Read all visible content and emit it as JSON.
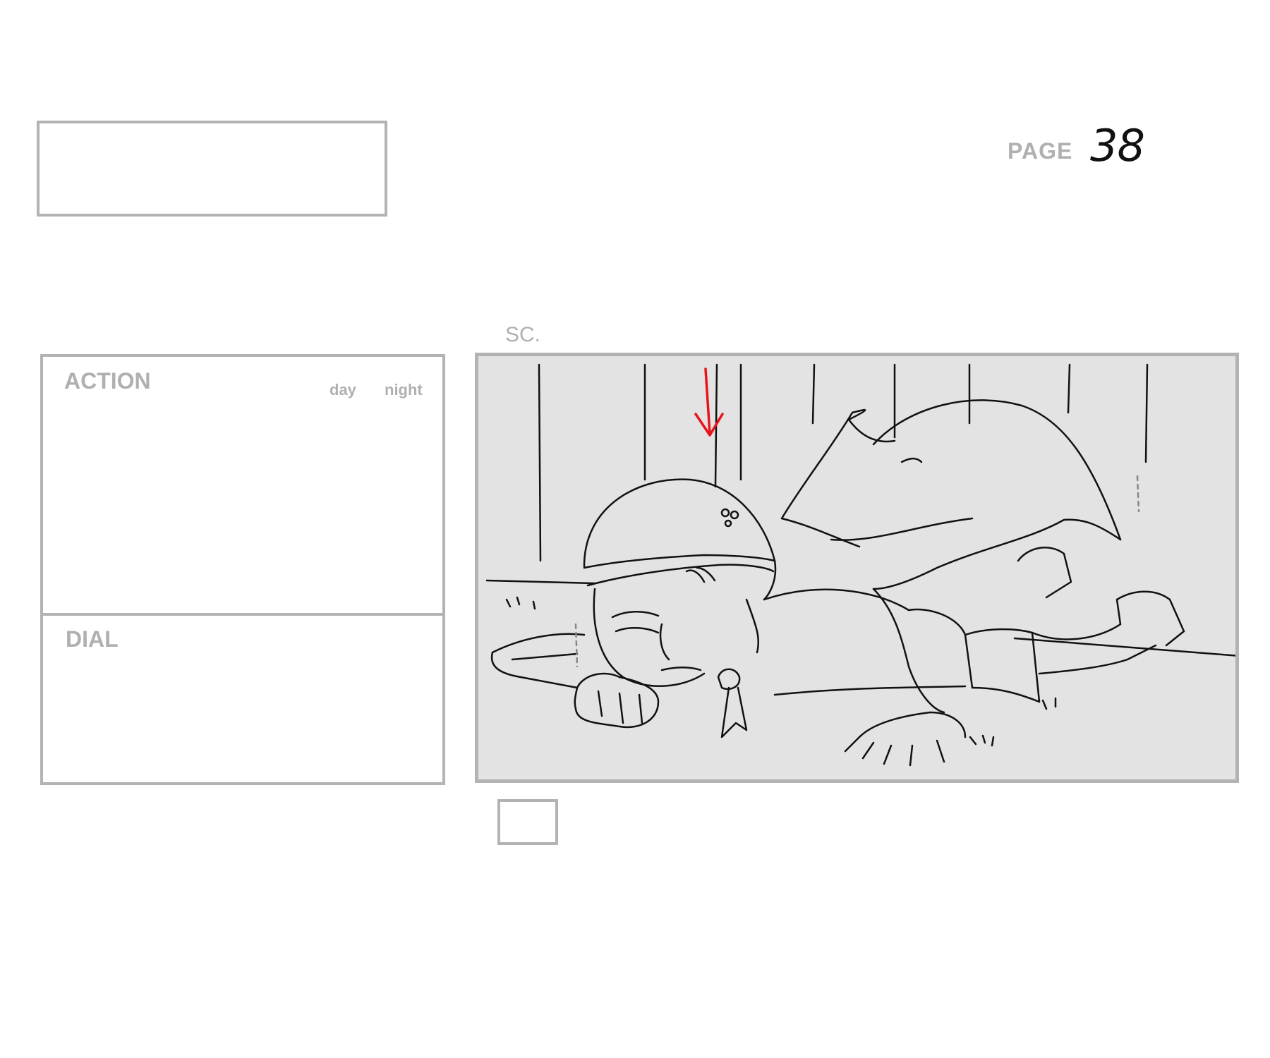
{
  "header": {
    "page_label": "PAGE",
    "page_number": "38"
  },
  "panel": {
    "scene_label": "SC."
  },
  "notes": {
    "action_label": "ACTION",
    "day_label": "day",
    "night_label": "night",
    "dial_label": "DIAL"
  },
  "drawing": {
    "description_icon": "storyboard-sketch",
    "arrow_color": "#e8131b",
    "line_color": "#111111",
    "background_color": "#e3e3e3"
  }
}
